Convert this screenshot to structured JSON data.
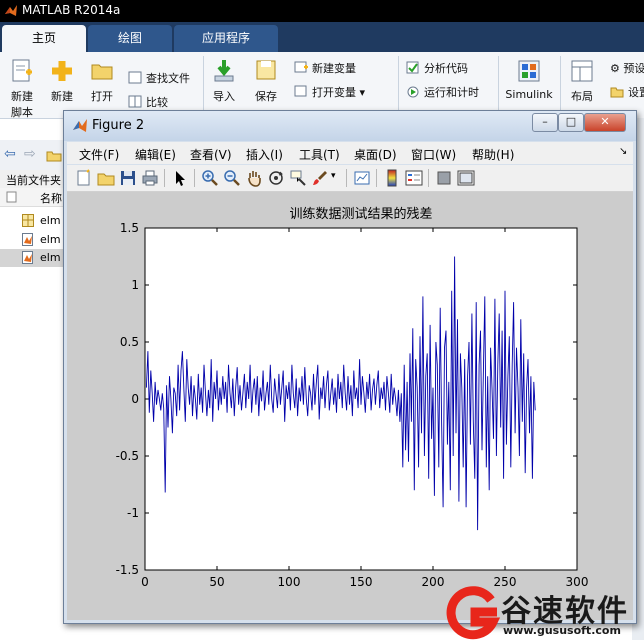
{
  "app": {
    "title": "MATLAB R2014a",
    "tabs": [
      {
        "label": "主页",
        "active": true
      },
      {
        "label": "绘图",
        "active": false
      },
      {
        "label": "应用程序",
        "active": false
      }
    ],
    "ribbon": {
      "new_script": "新建\n脚本",
      "new": "新建",
      "open": "打开",
      "find_files": "查找文件",
      "compare": "比较",
      "import": "导入",
      "save": "保存",
      "new_variable": "新建变量",
      "open_variable": "打开变量",
      "analyze_code": "分析代码",
      "run_and_time": "运行和计时",
      "simulink": "Simulink",
      "layout": "布局",
      "preferences": "预设",
      "set_path": "设置"
    },
    "current_folder_label": "当前文件夹",
    "files_header": "名称",
    "files": [
      {
        "name": "elm",
        "type": "folder"
      },
      {
        "name": "elm",
        "type": "m-file"
      },
      {
        "name": "elm",
        "type": "m-file",
        "selected": true
      }
    ]
  },
  "figure": {
    "title": "Figure 2",
    "window_buttons": {
      "minimize": "–",
      "maximize": "□",
      "close": "✕"
    },
    "menus": [
      "文件(F)",
      "编辑(E)",
      "查看(V)",
      "插入(I)",
      "工具(T)",
      "桌面(D)",
      "窗口(W)",
      "帮助(H)"
    ],
    "toolbar_icons": [
      "new-figure-icon",
      "open-file-icon",
      "save-icon",
      "print-icon",
      "pointer-icon",
      "zoom-in-icon",
      "zoom-out-icon",
      "pan-hand-icon",
      "rotate-3d-icon",
      "data-cursor-icon",
      "brush-icon",
      "link-plot-icon",
      "colorbar-icon",
      "legend-icon",
      "hide-plot-tools-icon",
      "show-plot-tools-icon"
    ]
  },
  "chart_data": {
    "type": "line",
    "title": "训练数据测试结果的残差",
    "xlabel": "",
    "ylabel": "",
    "xlim": [
      0,
      300
    ],
    "ylim": [
      -1.5,
      1.5
    ],
    "xticks": [
      "0",
      "50",
      "100",
      "150",
      "200",
      "250",
      "300"
    ],
    "yticks": [
      "1.5",
      "1",
      "0.5",
      "0",
      "-0.5",
      "-1",
      "-1.5"
    ],
    "grid": false,
    "line_color": "#0000aa",
    "x": [
      1,
      2,
      3,
      4,
      5,
      6,
      7,
      8,
      9,
      10,
      11,
      12,
      13,
      14,
      15,
      16,
      17,
      18,
      19,
      20,
      21,
      22,
      23,
      24,
      25,
      26,
      27,
      28,
      29,
      30,
      31,
      32,
      33,
      34,
      35,
      36,
      37,
      38,
      39,
      40,
      41,
      42,
      43,
      44,
      45,
      46,
      47,
      48,
      49,
      50,
      51,
      52,
      53,
      54,
      55,
      56,
      57,
      58,
      59,
      60,
      61,
      62,
      63,
      64,
      65,
      66,
      67,
      68,
      69,
      70,
      71,
      72,
      73,
      74,
      75,
      76,
      77,
      78,
      79,
      80,
      81,
      82,
      83,
      84,
      85,
      86,
      87,
      88,
      89,
      90,
      91,
      92,
      93,
      94,
      95,
      96,
      97,
      98,
      99,
      100,
      101,
      102,
      103,
      104,
      105,
      106,
      107,
      108,
      109,
      110,
      111,
      112,
      113,
      114,
      115,
      116,
      117,
      118,
      119,
      120,
      121,
      122,
      123,
      124,
      125,
      126,
      127,
      128,
      129,
      130,
      131,
      132,
      133,
      134,
      135,
      136,
      137,
      138,
      139,
      140,
      141,
      142,
      143,
      144,
      145,
      146,
      147,
      148,
      149,
      150,
      151,
      152,
      153,
      154,
      155,
      156,
      157,
      158,
      159,
      160,
      161,
      162,
      163,
      164,
      165,
      166,
      167,
      168,
      169,
      170,
      171,
      172,
      173,
      174,
      175,
      176,
      177,
      178,
      179,
      180,
      181,
      182,
      183,
      184,
      185,
      186,
      187,
      188,
      189,
      190,
      191,
      192,
      193,
      194,
      195,
      196,
      197,
      198,
      199,
      200,
      201,
      202,
      203,
      204,
      205,
      206,
      207,
      208,
      209,
      210,
      211,
      212,
      213,
      214,
      215,
      216,
      217,
      218,
      219,
      220,
      221,
      222,
      223,
      224,
      225,
      226,
      227,
      228,
      229,
      230,
      231,
      232,
      233,
      234,
      235,
      236,
      237,
      238,
      239,
      240,
      241,
      242,
      243,
      244,
      245,
      246,
      247,
      248,
      249,
      250,
      251,
      252,
      253,
      254,
      255,
      256,
      257,
      258,
      259,
      260,
      261,
      262,
      263,
      264,
      265,
      266,
      267,
      268,
      269,
      270,
      271,
      272,
      273,
      274,
      275,
      276,
      277,
      278,
      279,
      280
    ],
    "y": [
      0.1,
      0.42,
      -0.12,
      0.25,
      0.05,
      -0.2,
      0.15,
      -0.05,
      0.08,
      0.0,
      -0.1,
      0.05,
      -0.08,
      -0.82,
      0.12,
      -0.25,
      0.2,
      0.0,
      -0.3,
      0.1,
      0.05,
      -0.15,
      0.3,
      -0.1,
      0.25,
      0.42,
      0.08,
      -0.2,
      0.35,
      0.1,
      -0.05,
      0.2,
      -0.15,
      0.12,
      0.0,
      -0.18,
      0.22,
      -0.05,
      0.1,
      -0.12,
      0.3,
      0.05,
      -0.15,
      0.08,
      -0.08,
      0.35,
      -0.2,
      0.15,
      0.0,
      0.25,
      -0.1,
      0.1,
      -0.05,
      0.2,
      0.0,
      0.15,
      -0.12,
      0.3,
      0.05,
      -0.08,
      0.18,
      -0.15,
      0.1,
      0.28,
      -0.05,
      0.12,
      -0.1,
      0.05,
      0.22,
      -0.08,
      0.15,
      0.0,
      0.3,
      -0.12,
      0.08,
      0.18,
      -0.05,
      0.2,
      -0.15,
      0.1,
      -0.02,
      0.25,
      -0.1,
      0.05,
      0.15,
      -0.05,
      0.3,
      0.0,
      -0.12,
      0.18,
      0.05,
      -0.08,
      0.22,
      -0.05,
      0.1,
      0.25,
      -0.2,
      0.12,
      0.0,
      0.15,
      -0.1,
      0.3,
      0.05,
      -0.08,
      0.18,
      -0.15,
      0.1,
      -0.02,
      0.2,
      -0.05,
      0.28,
      0.0,
      -0.15,
      0.12,
      0.05,
      -0.1,
      0.22,
      -0.05,
      0.15,
      0.3,
      -0.18,
      0.1,
      0.0,
      0.2,
      -0.08,
      0.12,
      0.25,
      -0.1,
      0.05,
      0.18,
      -0.05,
      0.1,
      -0.12,
      0.22,
      0.0,
      0.15,
      -0.08,
      0.3,
      0.05,
      -0.1,
      0.2,
      -0.05,
      0.12,
      -0.15,
      0.25,
      0.0,
      0.1,
      -0.08,
      0.35,
      -0.05,
      0.2,
      0.05,
      -0.12,
      0.15,
      0.0,
      0.22,
      -0.1,
      0.08,
      0.18,
      -0.05,
      0.12,
      0.25,
      -0.08,
      0.1,
      0.0,
      0.15,
      -0.1,
      0.2,
      0.05,
      -0.12,
      0.22,
      -0.05,
      0.1,
      0.0,
      -0.15,
      0.08,
      -0.2,
      0.05,
      -0.6,
      0.3,
      -0.45,
      0.15,
      -0.55,
      0.4,
      -0.2,
      0.62,
      -0.8,
      0.35,
      0.1,
      -0.6,
      0.55,
      -0.3,
      0.9,
      -0.5,
      0.2,
      0.4,
      -0.7,
      0.65,
      -0.35,
      0.1,
      -0.85,
      0.5,
      0.3,
      -0.6,
      0.8,
      -0.2,
      -0.95,
      0.45,
      0.6,
      -0.4,
      0.15,
      -0.8,
      0.95,
      -0.5,
      1.25,
      -0.3,
      0.7,
      -0.9,
      0.4,
      0.1,
      -0.6,
      0.35,
      -0.95,
      0.2,
      0.5,
      -0.4,
      0.75,
      -0.2,
      -0.7,
      0.85,
      -1.15,
      0.3,
      0.6,
      -0.45,
      0.25,
      0.9,
      -0.6,
      0.2,
      -0.8,
      0.45,
      0.1,
      -0.35,
      0.88,
      -0.5,
      0.3,
      0.75,
      -0.25,
      0.6,
      -0.7,
      0.95,
      -0.4,
      0.2,
      0.55,
      -0.6,
      0.3,
      0.85,
      -0.3,
      0.45,
      0.1,
      -0.5,
      0.7,
      -0.2,
      0.4,
      -0.65,
      0.1,
      0.35,
      -0.3,
      0.2,
      -0.7,
      0.15,
      -0.1
    ]
  },
  "watermark": {
    "text": "谷速软件",
    "url": "www.gususoft.com",
    "color": "#e8261b"
  }
}
